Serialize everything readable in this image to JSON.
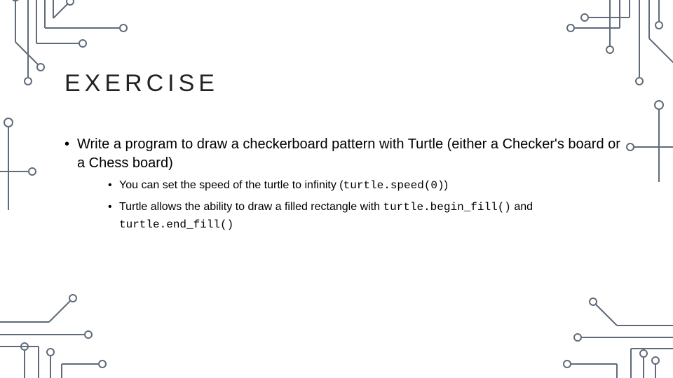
{
  "slide": {
    "title": "EXERCISE",
    "bullets": [
      {
        "text_a": "Write a program to draw a checkerboard pattern with Turtle (either a Checker's board or a Chess board)",
        "children": [
          {
            "text_a": "You can set the speed of the turtle to infinity (",
            "code_a": "turtle.speed(0)",
            "text_b": ")"
          },
          {
            "text_a": "Turtle allows the ability to draw a filled rectangle with ",
            "code_a": "turtle.begin_fill()",
            "text_b": " and ",
            "code_b": "turtle.end_fill()"
          }
        ]
      }
    ]
  }
}
